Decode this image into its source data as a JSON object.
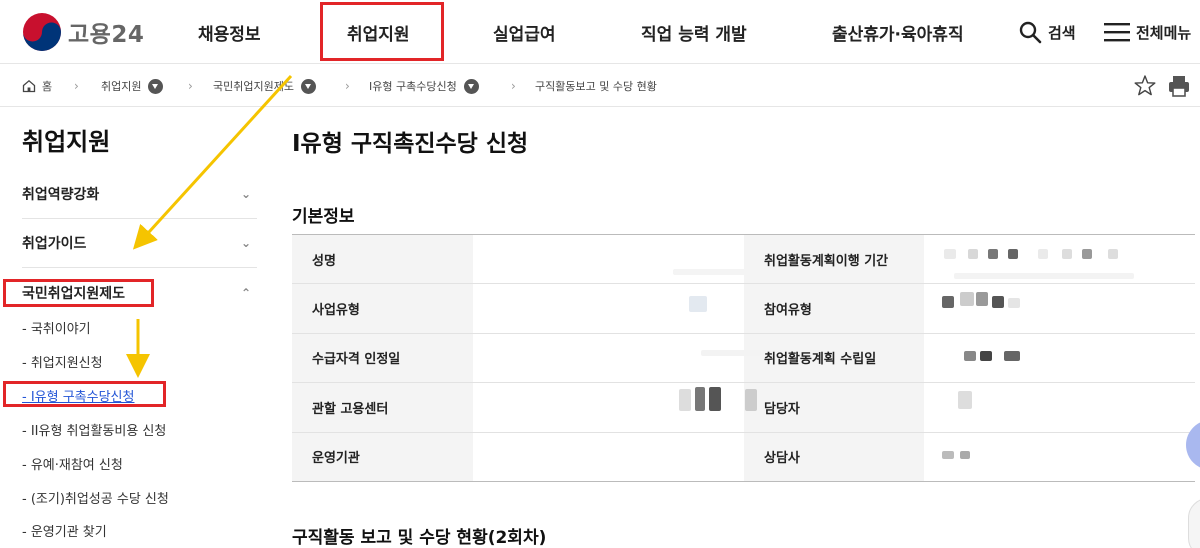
{
  "header": {
    "logo_text": "고용24",
    "nav": [
      "채용정보",
      "취업지원",
      "실업급여",
      "직업 능력 개발",
      "출산휴가·육아휴직"
    ],
    "search_label": "검색",
    "menu_label": "전체메뉴"
  },
  "breadcrumb": {
    "home": "홈",
    "items": [
      "취업지원",
      "국민취업지원제도",
      "I유형 구촉수당신청",
      "구직활동보고 및 수당 현황"
    ]
  },
  "sidebar": {
    "title": "취업지원",
    "groups": [
      {
        "label": "취업역량강화",
        "chevron": "⌄"
      },
      {
        "label": "취업가이드",
        "chevron": "⌄"
      },
      {
        "label": "국민취업지원제도",
        "chevron": "⌃"
      }
    ],
    "sub_items": [
      "- 국취이야기",
      "- 취업지원신청",
      "- I유형 구촉수당신청",
      "- II유형 취업활동비용 신청",
      "- 유예·재참여 신청",
      "- (조기)취업성공 수당 신청",
      "- 운영기관 찾기"
    ],
    "active_index": 2
  },
  "main": {
    "page_title": "I유형 구직촉진수당 신청",
    "section_basic": "기본정보",
    "rows": [
      {
        "left_label": "성명",
        "right_label": "취업활동계획이행 기간"
      },
      {
        "left_label": "사업유형",
        "right_label": "참여유형"
      },
      {
        "left_label": "수급자격 인정일",
        "right_label": "취업활동계획 수립일"
      },
      {
        "left_label": "관할 고용센터",
        "right_label": "담당자"
      },
      {
        "left_label": "운영기관",
        "right_label": "상담사"
      }
    ],
    "section_report": "구직활동 보고 및 수당 현황(2회차)"
  },
  "colors": {
    "highlight": "#e22528",
    "arrow": "#f5c400",
    "active_link": "#2355d6"
  }
}
